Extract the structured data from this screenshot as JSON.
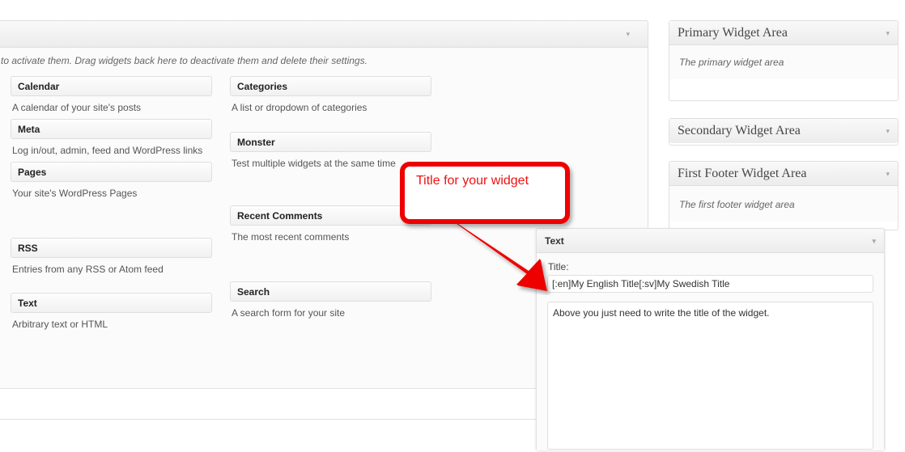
{
  "available_widgets": {
    "description": "to activate them. Drag widgets back here to deactivate them and delete their settings.",
    "caret": "▾",
    "column_a": [
      {
        "title": "Calendar",
        "desc": "A calendar of your site's posts"
      },
      {
        "title": "Meta",
        "desc": "Log in/out, admin, feed and WordPress links"
      },
      {
        "title": "Pages",
        "desc": "Your site's WordPress Pages"
      },
      {
        "title": "RSS",
        "desc": "Entries from any RSS or Atom feed"
      },
      {
        "title": "Text",
        "desc": "Arbitrary text or HTML"
      }
    ],
    "column_b": [
      {
        "title": "Categories",
        "desc": "A list or dropdown of categories"
      },
      {
        "title": "Monster",
        "desc": "Test multiple widgets at the same time"
      },
      {
        "title": "Recent Comments",
        "desc": "The most recent comments"
      },
      {
        "title": "Search",
        "desc": "A search form for your site"
      }
    ]
  },
  "sidebar": {
    "caret": "▾",
    "areas": [
      {
        "title": "Primary Widget Area",
        "desc": "The primary widget area",
        "collapsed": false
      },
      {
        "title": "Secondary Widget Area",
        "desc": "",
        "collapsed": true
      },
      {
        "title": "First Footer Widget Area",
        "desc": "The first footer widget area",
        "collapsed": false
      }
    ]
  },
  "text_widget": {
    "header_title": "Text",
    "caret": "▾",
    "title_label": "Title:",
    "title_value": "[:en]My English Title[:sv]My Swedish Title",
    "title_placeholder": "",
    "content_value": "Above you just need to write the title of the widget.",
    "content_placeholder": ""
  },
  "callout": {
    "text": "Title for your widget",
    "color": "#ee0000"
  }
}
